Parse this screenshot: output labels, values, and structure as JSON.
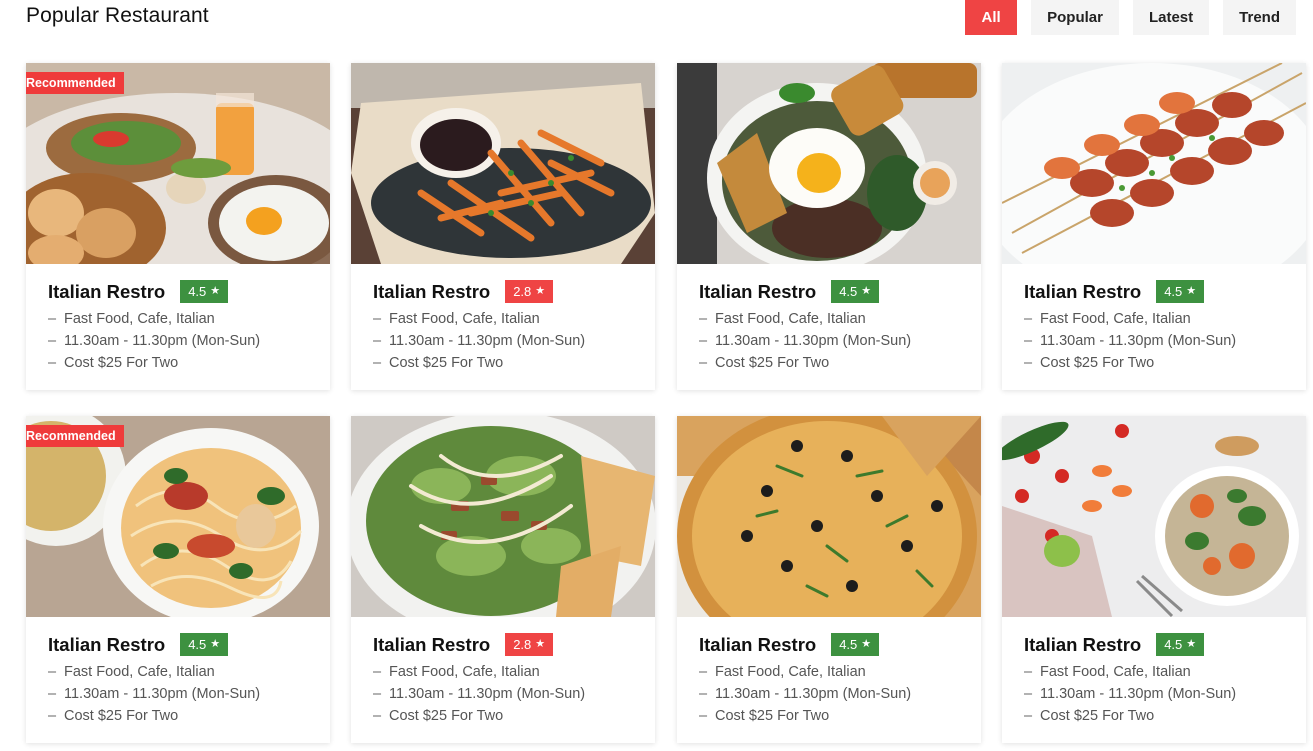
{
  "header": {
    "title": "Popular Restaurant",
    "filters": [
      {
        "label": "All",
        "active": true
      },
      {
        "label": "Popular",
        "active": false
      },
      {
        "label": "Latest",
        "active": false
      },
      {
        "label": "Trend",
        "active": false
      }
    ]
  },
  "cards": [
    {
      "name": "Italian Restro",
      "rating": "4.5",
      "rating_status": "good",
      "badge": "Recommended",
      "image": "breakfast-table",
      "cuisine": "Fast Food, Cafe, Italian",
      "hours": "11.30am - 11.30pm (Mon-Sun)",
      "cost": "Cost $25 For Two"
    },
    {
      "name": "Italian Restro",
      "rating": "2.8",
      "rating_status": "bad",
      "badge": "",
      "image": "fries-bowl",
      "cuisine": "Fast Food, Cafe, Italian",
      "hours": "11.30am - 11.30pm (Mon-Sun)",
      "cost": "Cost $25 For Two"
    },
    {
      "name": "Italian Restro",
      "rating": "4.5",
      "rating_status": "good",
      "badge": "",
      "image": "egg-bowl",
      "cuisine": "Fast Food, Cafe, Italian",
      "hours": "11.30am - 11.30pm (Mon-Sun)",
      "cost": "Cost $25 For Two"
    },
    {
      "name": "Italian Restro",
      "rating": "4.5",
      "rating_status": "good",
      "badge": "",
      "image": "shrimp-skewers",
      "cuisine": "Fast Food, Cafe, Italian",
      "hours": "11.30am - 11.30pm (Mon-Sun)",
      "cost": "Cost $25 For Two"
    },
    {
      "name": "Italian Restro",
      "rating": "4.5",
      "rating_status": "good",
      "badge": "Recommended",
      "image": "noodle-soup",
      "cuisine": "Fast Food, Cafe, Italian",
      "hours": "11.30am - 11.30pm (Mon-Sun)",
      "cost": "Cost $25 For Two"
    },
    {
      "name": "Italian Restro",
      "rating": "2.8",
      "rating_status": "bad",
      "badge": "",
      "image": "caesar-salad",
      "cuisine": "Fast Food, Cafe, Italian",
      "hours": "11.30am - 11.30pm (Mon-Sun)",
      "cost": "Cost $25 For Two"
    },
    {
      "name": "Italian Restro",
      "rating": "4.5",
      "rating_status": "good",
      "badge": "",
      "image": "pizza",
      "cuisine": "Fast Food, Cafe, Italian",
      "hours": "11.30am - 11.30pm (Mon-Sun)",
      "cost": "Cost $25 For Two"
    },
    {
      "name": "Italian Restro",
      "rating": "4.5",
      "rating_status": "good",
      "badge": "",
      "image": "veggie-bowl",
      "cuisine": "Fast Food, Cafe, Italian",
      "hours": "11.30am - 11.30pm (Mon-Sun)",
      "cost": "Cost $25 For Two"
    }
  ],
  "colors": {
    "accent": "#ef4444",
    "rating_good": "#3d9140",
    "rating_bad": "#ef4444"
  },
  "icons": {
    "rating": "star-icon"
  }
}
